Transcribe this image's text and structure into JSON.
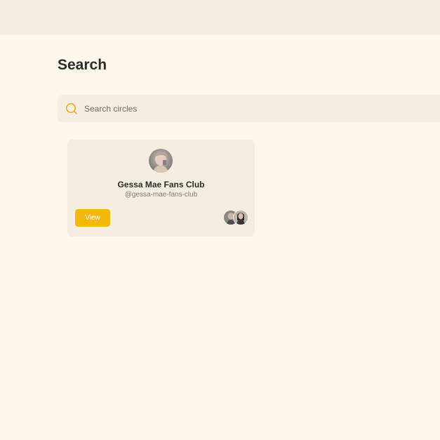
{
  "header": {
    "title": "Search"
  },
  "search": {
    "placeholder": "Search circles",
    "value": "",
    "icon": "search-icon",
    "icon_color": "#f3a11b"
  },
  "results": [
    {
      "name": "Gessa Mae Fans Club",
      "handle": "@gessa-mae-fans-club",
      "view_label": "View",
      "avatar": "circle-avatar",
      "member_avatars": [
        "member-avatar",
        "member-avatar"
      ]
    }
  ],
  "colors": {
    "background": "#fef8eb",
    "topbar": "#f5efe1",
    "card": "#f4eee1",
    "accent": "#f3b80b"
  }
}
